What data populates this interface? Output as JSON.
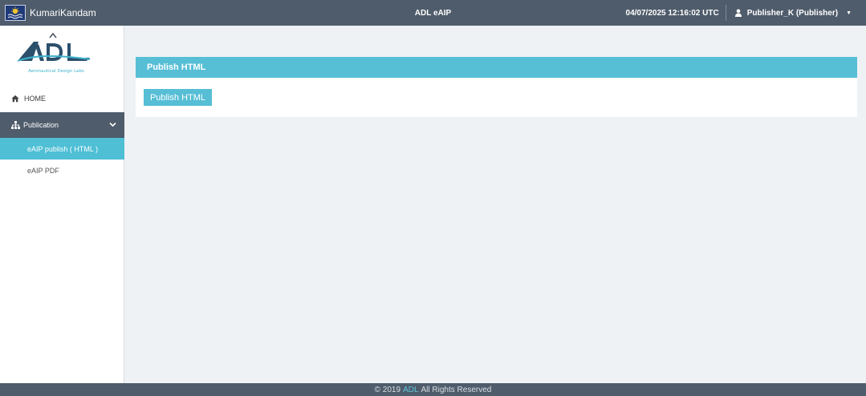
{
  "topbar": {
    "brand_name": "KumariKandam",
    "app_title": "ADL eAIP",
    "datetime": "04/07/2025 12:16:02 UTC",
    "user": "Publisher_K (Publisher)"
  },
  "sidebar": {
    "logo_subtitle": "Aeronautical Design Labs",
    "home_label": "HOME",
    "publication_label": "Publication",
    "items": [
      {
        "label": "eAIP publish ( HTML )"
      },
      {
        "label": "eAIP PDF"
      }
    ]
  },
  "main": {
    "panel_title": "Publish HTML",
    "publish_button": "Publish HTML"
  },
  "footer": {
    "prefix": "© 2019",
    "link": "ADL",
    "suffix": "All Rights Reserved"
  },
  "colors": {
    "topbar": "#4f5c6b",
    "accent": "#56bed5",
    "background": "#eef2f5"
  }
}
